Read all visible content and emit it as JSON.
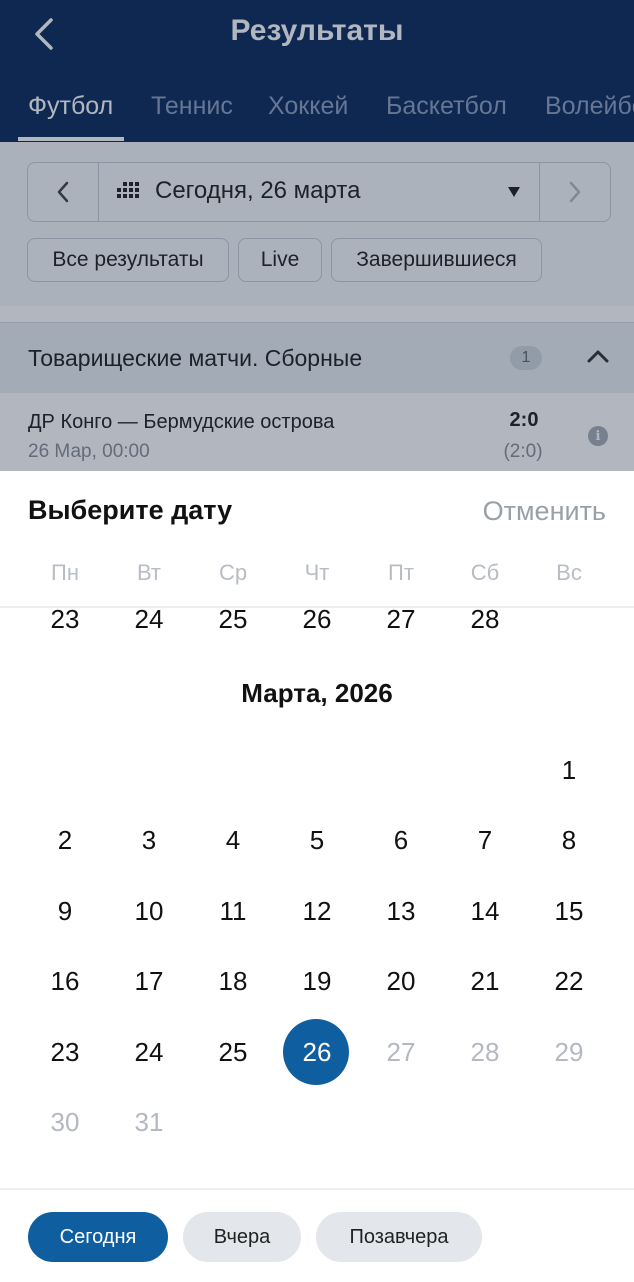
{
  "header": {
    "title": "Результаты",
    "sport_tabs": [
      "Футбол",
      "Теннис",
      "Хоккей",
      "Баскетбол",
      "Волейбол"
    ],
    "active_tab": "Футбол"
  },
  "filters": {
    "date_label": "Сегодня, 26 марта",
    "chips": [
      "Все результаты",
      "Live",
      "Завершившиеся"
    ]
  },
  "group": {
    "title": "Товарищеские матчи. Сборные",
    "count": "1"
  },
  "match": {
    "teams": "ДР Конго — Бермудские острова",
    "time": "26 Мар, 00:00",
    "score": "2:0",
    "half_score": "(2:0)"
  },
  "picker": {
    "title": "Выберите дату",
    "cancel": "Отменить",
    "weekdays": [
      "Пн",
      "Вт",
      "Ср",
      "Чт",
      "Пт",
      "Сб",
      "Вс"
    ],
    "prev_month_tail": [
      "23",
      "24",
      "25",
      "26",
      "27",
      "28"
    ],
    "month_title": "Марта, 2026",
    "first_day_column": 6,
    "days_in_month": 31,
    "selected_day": 26,
    "last_enabled_day": 26,
    "quick_buttons": [
      "Сегодня",
      "Вчера",
      "Позавчера"
    ]
  },
  "colors": {
    "header_bg": "#0b2a5c",
    "accent": "#0f5fa0"
  }
}
